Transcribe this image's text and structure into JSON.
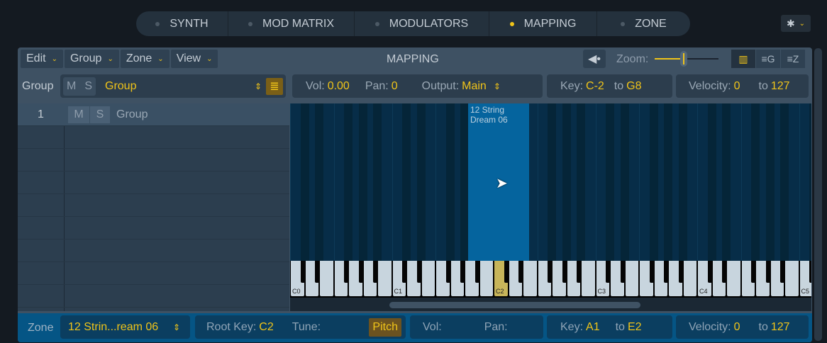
{
  "tabs": [
    {
      "label": "SYNTH",
      "active": false
    },
    {
      "label": "MOD MATRIX",
      "active": false
    },
    {
      "label": "MODULATORS",
      "active": false
    },
    {
      "label": "MAPPING",
      "active": true
    },
    {
      "label": "ZONE",
      "active": false
    }
  ],
  "settings_icon": "gear-icon",
  "accent": "#f0c419",
  "menu": {
    "items": [
      "Edit",
      "Group",
      "Zone",
      "View"
    ],
    "title": "MAPPING",
    "zoom_label": "Zoom:",
    "zoom_level": 0.46,
    "view_buttons": [
      "piano-view",
      "group-view",
      "zone-view"
    ],
    "view_group_label": "G",
    "view_zone_label": "Z",
    "speaker_icon": "speaker-icon"
  },
  "group_bar": {
    "label": "Group",
    "mute": "M",
    "solo": "S",
    "group_name": "Group",
    "vol_label": "Vol:",
    "vol": "0.00",
    "pan_label": "Pan:",
    "pan": "0",
    "output_label": "Output:",
    "output": "Main",
    "key_label": "Key:",
    "key_from": "C-2",
    "to_label": "to",
    "key_to": "G8",
    "vel_label": "Velocity:",
    "vel_from": "0",
    "vel_to": "127"
  },
  "groups": [
    {
      "index": "1",
      "mute": "M",
      "solo": "S",
      "name": "Group"
    }
  ],
  "zone_block": {
    "name_line1": "12 String",
    "name_line2": "Dream 06",
    "from": "A1",
    "to": "E2"
  },
  "keyboard": {
    "labels": [
      "C0",
      "C1",
      "C2",
      "C3",
      "C4",
      "C5"
    ],
    "highlight": "C2"
  },
  "zone_bar": {
    "label": "Zone",
    "zone_name": "12 Strin...ream 06",
    "root_label": "Root Key:",
    "root": "C2",
    "tune_label": "Tune:",
    "pitch": "Pitch",
    "vol_label": "Vol:",
    "pan_label": "Pan:",
    "key_label": "Key:",
    "key_from": "A1",
    "to_label": "to",
    "key_to": "E2",
    "vel_label": "Velocity:",
    "vel_from": "0",
    "vel_to": "127"
  }
}
